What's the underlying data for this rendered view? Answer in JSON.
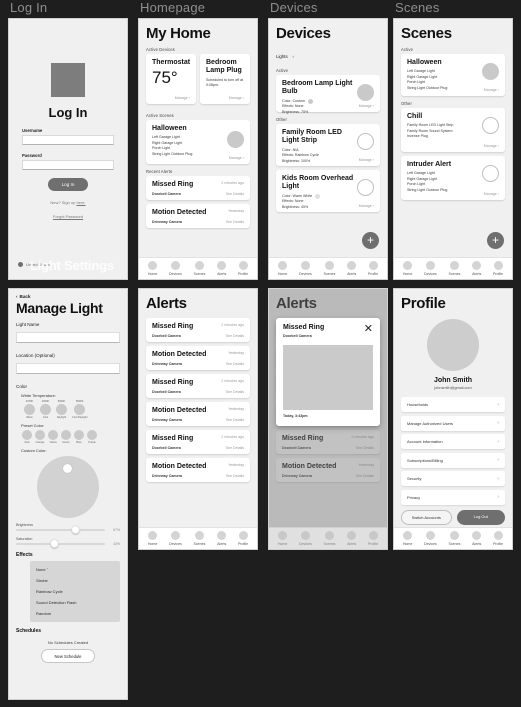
{
  "frames": {
    "login": "Log In",
    "homepage": "Homepage",
    "devices": "Devices",
    "scenes": "Scenes",
    "light_settings": "Light Settings"
  },
  "nav": {
    "items": [
      {
        "label": "Home",
        "icon": "home-icon"
      },
      {
        "label": "Devices",
        "icon": "devices-icon"
      },
      {
        "label": "Scenes",
        "icon": "scenes-icon"
      },
      {
        "label": "Alerts",
        "icon": "alerts-icon"
      },
      {
        "label": "Profile",
        "icon": "profile-icon"
      }
    ]
  },
  "login": {
    "heading": "Log In",
    "username_label": "Username",
    "username_value": "",
    "password_label": "Password",
    "password_value": "",
    "submit_label": "Log In",
    "signup_text": "New? Sign up ",
    "signup_link": "here.",
    "forgot_label": "Forgot Password",
    "region": "United States"
  },
  "homepage": {
    "title": "My Home",
    "sections": {
      "active_devices": "Active Devices",
      "active_scenes": "Active Scenes",
      "recent_alerts": "Recent Alerts"
    },
    "devices": [
      {
        "name": "Thermostat",
        "value": "75°",
        "note": "",
        "manage": "Manage"
      },
      {
        "name": "Bedroom Lamp Plug",
        "value": "",
        "note": "Scheduled to turn off at 9:08pm.",
        "manage": "Manage"
      }
    ],
    "scene": {
      "name": "Halloween",
      "lights": [
        "Left Garage Light",
        "Right Garage Light",
        "Porch Light",
        "String Light Outdoor Plug"
      ],
      "manage": "Manage"
    },
    "alerts": [
      {
        "title": "Missed Ring",
        "source": "Doorbell Camera",
        "time": "2 minutes ago",
        "action": "See Details"
      },
      {
        "title": "Motion Detected",
        "source": "Driveway Camera",
        "time": "Yesterday",
        "action": "See Details"
      }
    ]
  },
  "devices": {
    "title": "Devices",
    "filter_label": "Lights",
    "sections": {
      "active": "Active",
      "other": "Other"
    },
    "active": [
      {
        "name": "Bedroom Lamp Light Bulb",
        "color": "Color: Custom",
        "effects": "Effects: None",
        "brightness": "Brightness: 75%",
        "manage": "Manage",
        "on": true
      }
    ],
    "other": [
      {
        "name": "Family Room LED Light Strip",
        "color": "Color: N/A",
        "effects": "Effects: Rainbow Cycle",
        "brightness": "Brightness: 100%",
        "manage": "Manage",
        "on": false
      },
      {
        "name": "Kids Room Overhead Light",
        "color": "Color: Warm White",
        "effects": "Effects: None",
        "brightness": "Brightness: 45%",
        "manage": "Manage",
        "on": false
      }
    ],
    "add_label": "+"
  },
  "scenes": {
    "title": "Scenes",
    "sections": {
      "active": "Active",
      "other": "Other"
    },
    "active": [
      {
        "name": "Halloween",
        "items": [
          "Left Garage Light",
          "Right Garage Light",
          "Porch Light",
          "String Light Outdoor Plug"
        ],
        "manage": "Manage",
        "on": true
      }
    ],
    "other": [
      {
        "name": "Chill",
        "items": [
          "Family Room LED Light Strip",
          "Family Room Sound System",
          "Incense Plug"
        ],
        "manage": "Manage",
        "on": false
      },
      {
        "name": "Intruder Alert",
        "items": [
          "Left Garage Light",
          "Right Garage Light",
          "Porch Light",
          "String Light Outdoor Plug"
        ],
        "manage": "Manage",
        "on": false
      }
    ],
    "add_label": "+"
  },
  "manage_light": {
    "back_label": "Back",
    "title": "Manage Light",
    "name_label": "Light Name",
    "name_value": "",
    "location_label": "Location (Optional)",
    "location_value": "",
    "color_label": "Color",
    "white_temp_label": "White Temperature:",
    "white_temps": [
      {
        "kelvin": "2700K",
        "name": "Warm"
      },
      {
        "kelvin": "4000K",
        "name": "Cool"
      },
      {
        "kelvin": "5000K",
        "name": "Daylight"
      },
      {
        "kelvin": "6500K",
        "name": "Cool Daylight"
      }
    ],
    "preset_label": "Preset Color:",
    "presets": [
      "Red",
      "Orange",
      "Yellow",
      "Green",
      "Blue",
      "Purple"
    ],
    "custom_label": "Custom Color:",
    "brightness_label": "Brightness",
    "brightness_value": "67%",
    "brightness_pct": 67,
    "saturation_label": "Saturation",
    "saturation_value": "43%",
    "saturation_pct": 43,
    "effects_label": "Effects",
    "effects_selected": "None",
    "effects_options": [
      "None",
      "Strobe",
      "Rainbow Cycle",
      "Sound Detection Flash",
      "Random"
    ],
    "schedules_label": "Schedules",
    "schedules_empty": "No Schedules Created",
    "new_schedule_label": "New Schedule"
  },
  "alerts": {
    "title": "Alerts",
    "items": [
      {
        "title": "Missed Ring",
        "source": "Doorbell Camera",
        "time": "2 minutes ago",
        "action": "See Details"
      },
      {
        "title": "Motion Detected",
        "source": "Driveway Camera",
        "time": "Yesterday",
        "action": "See Details"
      },
      {
        "title": "Missed Ring",
        "source": "Doorbell Camera",
        "time": "2 minutes ago",
        "action": "See Details"
      },
      {
        "title": "Motion Detected",
        "source": "Driveway Camera",
        "time": "Yesterday",
        "action": "See Details"
      },
      {
        "title": "Missed Ring",
        "source": "Doorbell Camera",
        "time": "2 minutes ago",
        "action": "See Details"
      },
      {
        "title": "Motion Detected",
        "source": "Driveway Camera",
        "time": "Yesterday",
        "action": "See Details"
      }
    ]
  },
  "alert_detail": {
    "title": "Alerts",
    "modal": {
      "title": "Missed Ring",
      "source": "Doorbell Camera",
      "timestamp": "Today, 3:43pm",
      "close_icon": "close-icon"
    }
  },
  "profile": {
    "title": "Profile",
    "name": "John Smith",
    "email": "johnsmith@gmail.com",
    "menu": [
      "Households",
      "Manage Authorized Users",
      "Account Information",
      "Subscriptions/Billing",
      "Security",
      "Privacy"
    ],
    "switch_label": "Switch Accounts",
    "logout_label": "Log Out"
  }
}
